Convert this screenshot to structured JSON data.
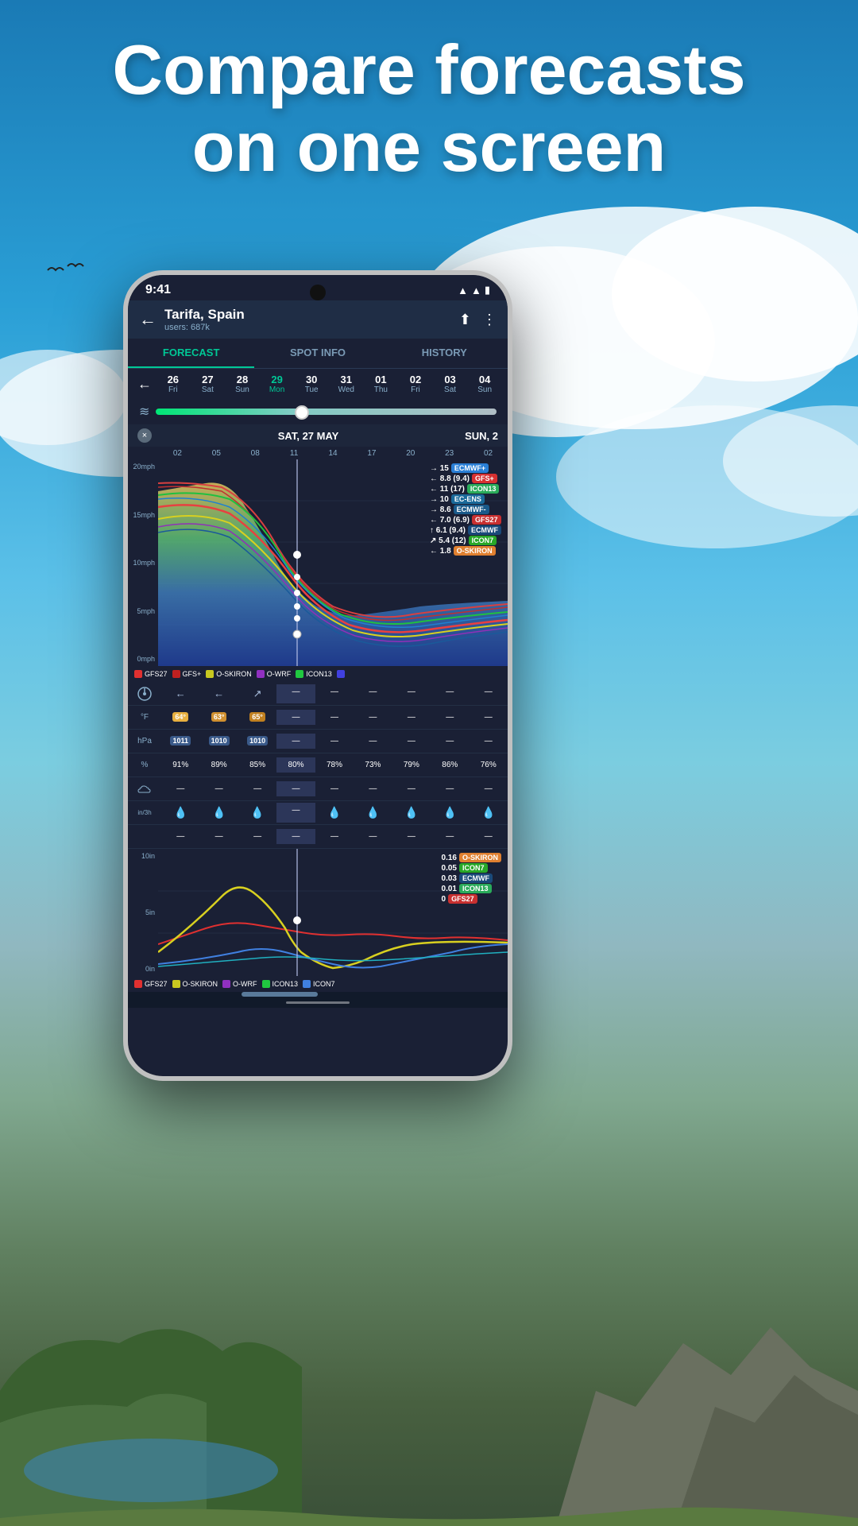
{
  "hero": {
    "title_line1": "Compare forecasts",
    "title_line2": "on one screen"
  },
  "phone": {
    "status": {
      "time": "9:41"
    },
    "header": {
      "location": "Tarifa, Spain",
      "users": "users: 687k",
      "back_label": "←",
      "share_label": "⬆",
      "menu_label": "⋮"
    },
    "tabs": [
      {
        "label": "FORECAST",
        "active": true
      },
      {
        "label": "SPOT INFO",
        "active": false
      },
      {
        "label": "HISTORY",
        "active": false
      }
    ],
    "dates": [
      {
        "num": "26",
        "day": "Fri"
      },
      {
        "num": "27",
        "day": "Sat"
      },
      {
        "num": "28",
        "day": "Sun"
      },
      {
        "num": "29",
        "day": "Mon",
        "active": true
      },
      {
        "num": "30",
        "day": "Tue"
      },
      {
        "num": "31",
        "day": "Wed"
      },
      {
        "num": "01",
        "day": "Thu"
      },
      {
        "num": "02",
        "day": "Fri"
      },
      {
        "num": "03",
        "day": "Sat"
      },
      {
        "num": "04",
        "day": "Sun"
      }
    ],
    "date_header": {
      "left": "SAT, 27 MAY",
      "right": "SUN, 2"
    },
    "time_labels": [
      "02",
      "05",
      "08",
      "11",
      "14",
      "17",
      "20",
      "23",
      "02"
    ],
    "wind_y_labels": [
      "20mph",
      "15mph",
      "10mph",
      "5mph",
      "0mph"
    ],
    "forecast_values": [
      {
        "arrow": "→",
        "val": "15",
        "badge": "ECMWF+",
        "badge_class": "badge-ecmwf-plus"
      },
      {
        "arrow": "←",
        "val": "8.8 (9.4)",
        "badge": "GFS+",
        "badge_class": "badge-gfs-plus"
      },
      {
        "arrow": "←",
        "val": "11 (17)",
        "badge": "ICON13",
        "badge_class": "badge-icon13"
      },
      {
        "arrow": "→",
        "val": "10",
        "badge": "EC-ENS",
        "badge_class": "badge-ec-ens"
      },
      {
        "arrow": "→",
        "val": "8.6",
        "badge": "ECMWF-",
        "badge_class": "badge-ecmwf"
      },
      {
        "arrow": "←",
        "val": "7.0 (6.9)",
        "badge": "GFS27",
        "badge_class": "badge-gfs27"
      },
      {
        "arrow": "↑",
        "val": "6.1 (9.4)",
        "badge": "ECMWF",
        "badge_class": "badge-ecmwf2"
      },
      {
        "arrow": "↗",
        "val": "5.4 (12)",
        "badge": "ICON7",
        "badge_class": "badge-icon7"
      },
      {
        "arrow": "←",
        "val": "1.8",
        "badge": "O-SKIRON",
        "badge_class": "badge-o-skiron"
      }
    ],
    "legend": [
      {
        "label": "GFS27",
        "color": "#e03030"
      },
      {
        "label": "GFS+",
        "color": "#c02020"
      },
      {
        "label": "O-SKIRON",
        "color": "#c8c820"
      },
      {
        "label": "O-WRF",
        "color": "#9030c0"
      },
      {
        "label": "ICON13",
        "color": "#20c840"
      },
      {
        "label": "",
        "color": "#4040e0"
      }
    ],
    "data_rows": {
      "directions": {
        "cols": [
          "←",
          "←",
          "↗",
          "—",
          "—",
          "—",
          "—",
          "—",
          "—"
        ]
      },
      "temperature": {
        "unit": "°F",
        "cols": [
          "64°",
          "63°",
          "65°",
          "—",
          "—",
          "—",
          "—",
          "—",
          "—"
        ]
      },
      "pressure": {
        "unit": "hPa",
        "cols": [
          "1011",
          "1010",
          "1010",
          "—",
          "—",
          "—",
          "—",
          "—",
          "—"
        ]
      },
      "humidity": {
        "unit": "%",
        "cols": [
          "91%",
          "89%",
          "85%",
          "80%",
          "78%",
          "73%",
          "79%",
          "86%",
          "76%"
        ]
      },
      "precip_in3h": {
        "unit": "in/3h",
        "cols": [
          "—",
          "—",
          "—",
          "—",
          "—",
          "—",
          "—",
          "—",
          "—"
        ]
      }
    },
    "rain_y_labels": [
      "10in",
      "5in",
      "0in"
    ],
    "rain_tooltip": [
      {
        "val": "0.16",
        "badge": "O-SKIRON",
        "badge_class": "badge-o-skiron"
      },
      {
        "val": "0.05",
        "badge": "ICON7",
        "badge_class": "badge-icon7"
      },
      {
        "val": "0.03",
        "badge": "ECMWF",
        "badge_class": "badge-ecmwf2"
      },
      {
        "val": "0.01",
        "badge": "ICON13",
        "badge_class": "badge-icon13"
      },
      {
        "val": "0",
        "badge": "GFS27",
        "badge_class": "badge-gfs27"
      }
    ],
    "bottom_legend": [
      {
        "label": "GFS27",
        "color": "#e03030"
      },
      {
        "label": "O-SKIRON",
        "color": "#c8c820"
      },
      {
        "label": "O-WRF",
        "color": "#9030c0"
      },
      {
        "label": "ICON13",
        "color": "#20c840"
      },
      {
        "label": "ICON7",
        "color": "#4080e0"
      }
    ]
  }
}
